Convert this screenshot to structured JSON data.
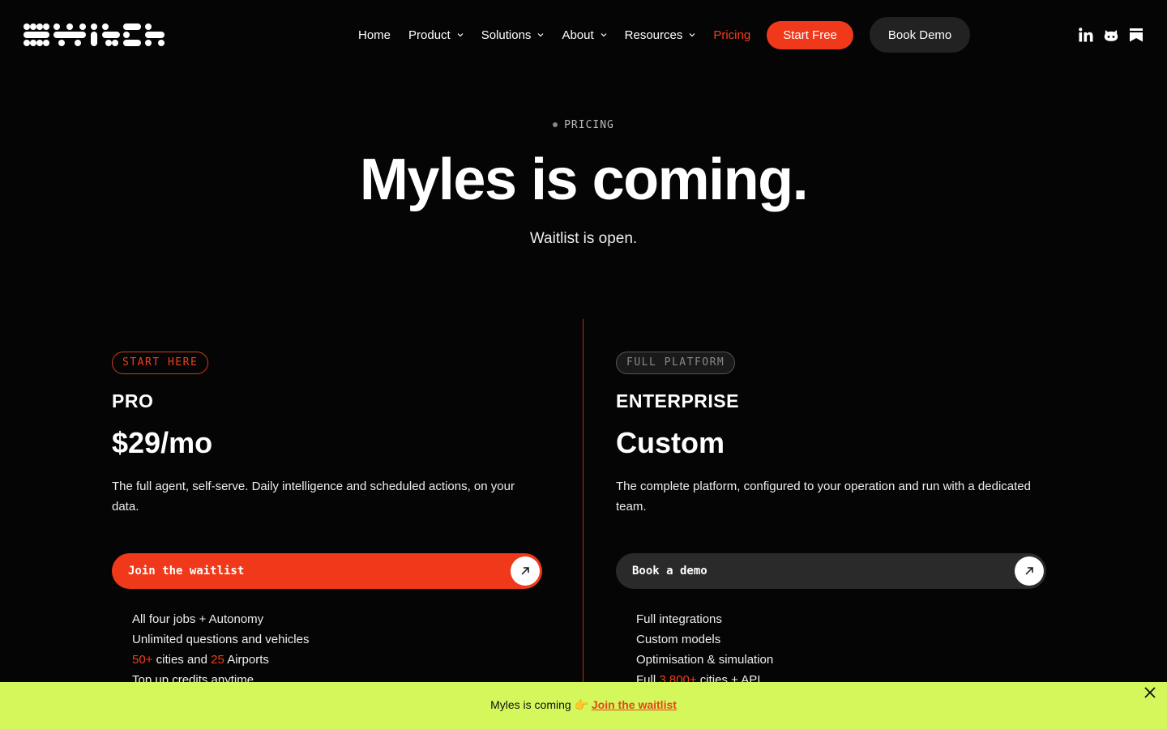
{
  "header": {
    "logo_alt": "SWITCH",
    "nav": [
      {
        "label": "Home",
        "has_dropdown": false
      },
      {
        "label": "Product",
        "has_dropdown": true
      },
      {
        "label": "Solutions",
        "has_dropdown": true
      },
      {
        "label": "About",
        "has_dropdown": true
      },
      {
        "label": "Resources",
        "has_dropdown": true
      },
      {
        "label": "Pricing",
        "has_dropdown": false,
        "active": true
      }
    ],
    "start_free_label": "Start Free",
    "book_demo_label": "Book Demo",
    "socials": [
      "linkedin-icon",
      "github-icon",
      "bookmark-icon"
    ]
  },
  "hero": {
    "eyebrow": "PRICING",
    "title": "Myles is coming.",
    "subtitle": "Waitlist is open."
  },
  "plans": {
    "pro": {
      "badge": "START HERE",
      "name": "PRO",
      "price": "$29/mo",
      "description": "The full agent, self-serve. Daily intelligence and scheduled actions, on your data.",
      "cta": "Join the waitlist",
      "features": {
        "f1": "All four jobs + Autonomy",
        "f2": "Unlimited questions and vehicles",
        "f3_num1": "50+",
        "f3_mid": " cities and ",
        "f3_num2": "25",
        "f3_end": " Airports",
        "f4": "Top up credits anytime"
      }
    },
    "enterprise": {
      "badge": "FULL PLATFORM",
      "name": "ENTERPRISE",
      "price": "Custom",
      "description": "The complete platform, configured to your operation and run with a dedicated team.",
      "cta": "Book a demo",
      "features": {
        "f1": "Full integrations",
        "f2": "Custom models",
        "f3": "Optimisation & simulation",
        "f4_pre": "Full ",
        "f4_num": "3,800+",
        "f4_end": " cities + API"
      }
    }
  },
  "banner": {
    "text": "Myles is coming 👉 ",
    "link": "Join the waitlist"
  },
  "colors": {
    "accent": "#f0391a",
    "banner_bg": "#d4f75c",
    "background": "#050505"
  }
}
